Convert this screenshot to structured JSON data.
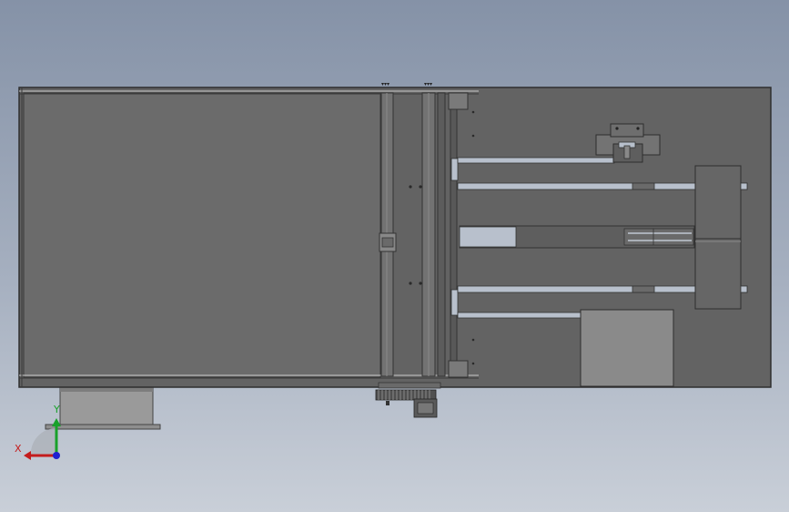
{
  "viewport": {
    "view": "top",
    "background_top": "#8592a7",
    "background_bottom": "#c9cfd8"
  },
  "colors": {
    "sheet": "#656565",
    "frame_edge": "#3c3c3c",
    "rail": "#b8c0cc",
    "block": "#8a8a8a",
    "dark_part": "#4a4a4a"
  },
  "triad": {
    "x_label": "X",
    "y_label": "Y",
    "x_color": "#c41c1c",
    "y_color": "#19a12a",
    "z_color": "#2020d0"
  }
}
